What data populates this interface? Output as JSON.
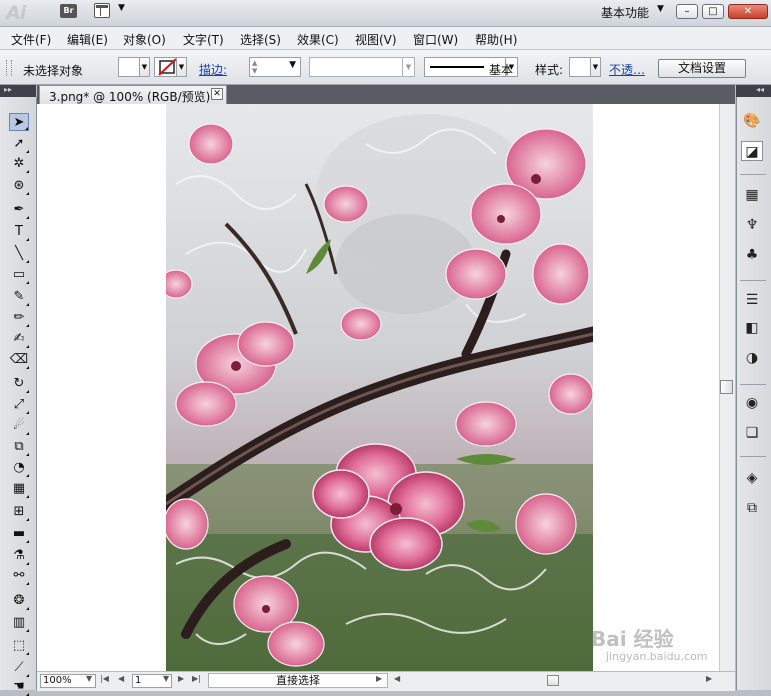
{
  "app": {
    "logo": "Ai",
    "bridge_label": "Br",
    "workspace": "基本功能"
  },
  "window_controls": {
    "minimize": "–",
    "maximize": "□",
    "close": "✕"
  },
  "menu": [
    "文件(F)",
    "编辑(E)",
    "对象(O)",
    "文字(T)",
    "选择(S)",
    "效果(C)",
    "视图(V)",
    "窗口(W)",
    "帮助(H)"
  ],
  "control_bar": {
    "selection_status": "未选择对象",
    "stroke_label": "描边:",
    "brush_label": "基本",
    "style_label": "样式:",
    "opacity_label": "不透…",
    "doc_setup_button": "文档设置"
  },
  "document": {
    "tab_title": "3.png* @ 100% (RGB/预览)",
    "close": "✕"
  },
  "status_bar": {
    "zoom": "100%",
    "page": "1",
    "current_tool": "直接选择"
  },
  "tools": [
    {
      "name": "selection-tool",
      "glyph": "➤",
      "active": true
    },
    {
      "name": "direct-selection-tool",
      "glyph": "➚"
    },
    {
      "name": "magic-wand-tool",
      "glyph": "✲"
    },
    {
      "name": "lasso-tool",
      "glyph": "⊛"
    },
    {
      "name": "pen-tool",
      "glyph": "✒"
    },
    {
      "name": "type-tool",
      "glyph": "T"
    },
    {
      "name": "line-segment-tool",
      "glyph": "╲"
    },
    {
      "name": "rectangle-tool",
      "glyph": "▭"
    },
    {
      "name": "paintbrush-tool",
      "glyph": "✎"
    },
    {
      "name": "pencil-tool",
      "glyph": "✏"
    },
    {
      "name": "blob-brush-tool",
      "glyph": "✍"
    },
    {
      "name": "eraser-tool",
      "glyph": "⌫"
    },
    {
      "name": "rotate-tool",
      "glyph": "↻"
    },
    {
      "name": "scale-tool",
      "glyph": "⤢"
    },
    {
      "name": "warp-tool",
      "glyph": "☄"
    },
    {
      "name": "free-transform-tool",
      "glyph": "⧉"
    },
    {
      "name": "shape-builder-tool",
      "glyph": "◔"
    },
    {
      "name": "perspective-grid-tool",
      "glyph": "▦"
    },
    {
      "name": "mesh-tool",
      "glyph": "⊞"
    },
    {
      "name": "gradient-tool",
      "glyph": "▬"
    },
    {
      "name": "eyedropper-tool",
      "glyph": "⚗"
    },
    {
      "name": "blend-tool",
      "glyph": "⚯"
    },
    {
      "name": "symbol-sprayer-tool",
      "glyph": "❂"
    },
    {
      "name": "column-graph-tool",
      "glyph": "▥"
    },
    {
      "name": "artboard-tool",
      "glyph": "⬚"
    },
    {
      "name": "slice-tool",
      "glyph": "⟋"
    },
    {
      "name": "hand-tool",
      "glyph": "☚"
    }
  ],
  "panels": [
    {
      "name": "color-panel-icon",
      "glyph": "🎨"
    },
    {
      "name": "color-guide-panel-icon",
      "glyph": "◪"
    },
    {
      "name": "swatches-panel-icon",
      "glyph": "▦"
    },
    {
      "name": "brushes-panel-icon",
      "glyph": "♆"
    },
    {
      "name": "symbols-panel-icon",
      "glyph": "♣"
    },
    {
      "name": "stroke-panel-icon",
      "glyph": "☰"
    },
    {
      "name": "gradient-panel-icon",
      "glyph": "◧"
    },
    {
      "name": "transparency-panel-icon",
      "glyph": "◑"
    },
    {
      "name": "appearance-panel-icon",
      "glyph": "◉"
    },
    {
      "name": "graphic-styles-panel-icon",
      "glyph": "❏"
    },
    {
      "name": "layers-panel-icon",
      "glyph": "◈"
    },
    {
      "name": "artboards-panel-icon",
      "glyph": "⧉"
    }
  ],
  "watermark": {
    "brand": "Bai 经验",
    "url": "jingyan.baidu.com"
  }
}
